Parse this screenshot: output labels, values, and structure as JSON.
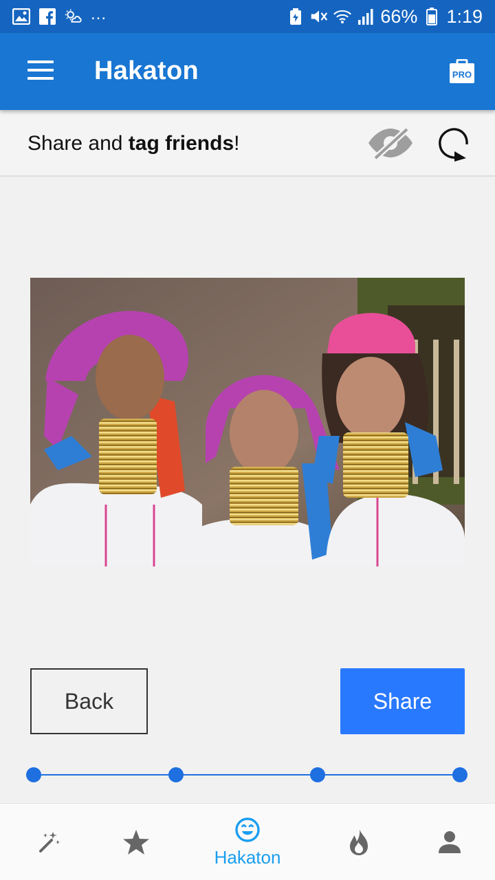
{
  "status_bar": {
    "left_icons": [
      "gallery-icon",
      "facebook-icon",
      "weather-icon"
    ],
    "more": "...",
    "battery_percent": "66%",
    "time": "1:19",
    "right_icons": [
      "battery-saver-icon",
      "mute-icon",
      "wifi-icon",
      "signal-icon",
      "battery-icon"
    ]
  },
  "app_bar": {
    "title": "Hakaton",
    "menu_icon": "menu-icon",
    "pro_badge": "PRO",
    "background": "#1976d2"
  },
  "subheader": {
    "text_prefix": "Share and ",
    "text_bold": "tag friends",
    "text_suffix": "!",
    "actions": [
      "eye-off-icon",
      "rotate-icon"
    ]
  },
  "photo": {
    "description_icon": "face-swap-photo"
  },
  "buttons": {
    "back_label": "Back",
    "share_label": "Share",
    "share_color": "#2979ff"
  },
  "stepper": {
    "steps": 4,
    "current_step": 4,
    "color": "#1e6fe0"
  },
  "bottom_nav": {
    "items": [
      {
        "icon": "magic-wand-icon",
        "label": ""
      },
      {
        "icon": "star-icon",
        "label": ""
      },
      {
        "icon": "smile-icon",
        "label": "Hakaton",
        "active": true
      },
      {
        "icon": "fire-icon",
        "label": ""
      },
      {
        "icon": "person-icon",
        "label": ""
      }
    ],
    "active_color": "#1a9ef0"
  }
}
